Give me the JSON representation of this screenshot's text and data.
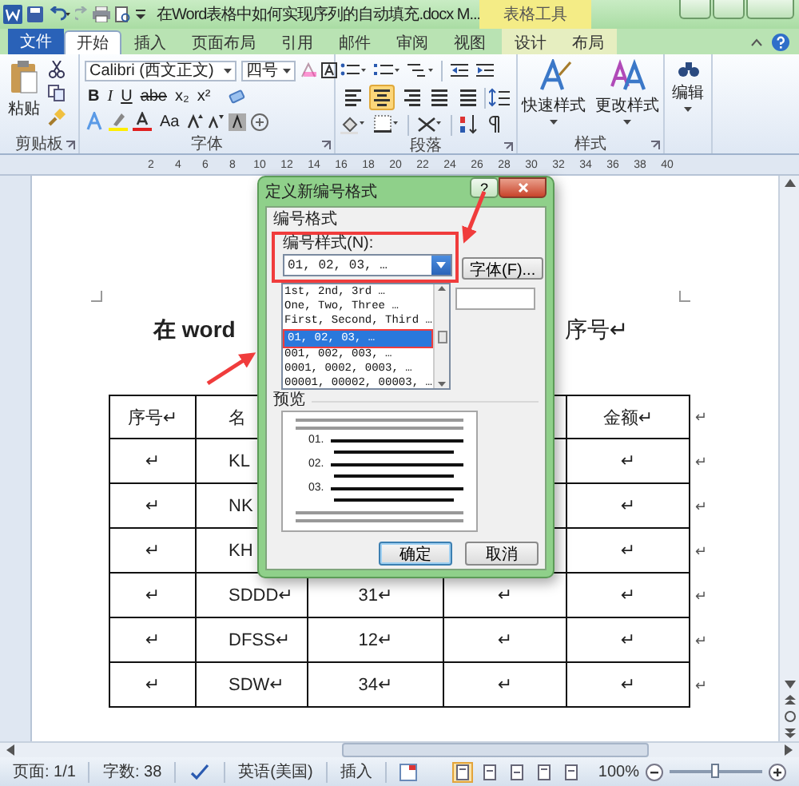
{
  "window": {
    "title": "在Word表格中如何实现序列的自动填充.docx M...",
    "context_group": "表格工具"
  },
  "file_tab": "文件",
  "tabs": [
    {
      "label": "开始",
      "selected": true,
      "contextual": false
    },
    {
      "label": "插入",
      "selected": false,
      "contextual": false
    },
    {
      "label": "页面布局",
      "selected": false,
      "contextual": false
    },
    {
      "label": "引用",
      "selected": false,
      "contextual": false
    },
    {
      "label": "邮件",
      "selected": false,
      "contextual": false
    },
    {
      "label": "审阅",
      "selected": false,
      "contextual": false
    },
    {
      "label": "视图",
      "selected": false,
      "contextual": false
    },
    {
      "label": "设计",
      "selected": false,
      "contextual": true
    },
    {
      "label": "布局",
      "selected": false,
      "contextual": true
    }
  ],
  "ribbon": {
    "clipboard": {
      "label": "剪贴板",
      "paste": "粘贴"
    },
    "font": {
      "label": "字体",
      "font_name": "Calibri (西文正文)",
      "font_size": "四号",
      "format_buttons": [
        "B",
        "I",
        "U",
        "abe",
        "x₂",
        "x²"
      ],
      "case_button": "Aa"
    },
    "paragraph": {
      "label": "段落",
      "align_buttons": [
        {
          "selected": false
        },
        {
          "selected": true
        },
        {
          "selected": false
        },
        {
          "selected": false
        },
        {
          "selected": false
        }
      ]
    },
    "styles": {
      "label": "样式",
      "buttons": [
        "快速样式",
        "更改样式"
      ]
    },
    "editing": {
      "label": "编辑"
    }
  },
  "ruler": [
    "2",
    "4",
    "6",
    "8",
    "10",
    "12",
    "14",
    "16",
    "18",
    "20",
    "22",
    "24",
    "26",
    "28",
    "30",
    "32",
    "34",
    "36",
    "38",
    "40"
  ],
  "document": {
    "heading_start": "在 word",
    "heading_end": "序号↵",
    "table": {
      "header": {
        "cells": [
          "序号↵",
          "名",
          null,
          null,
          "金额↵"
        ],
        "end": "↵"
      },
      "rows": [
        {
          "cells": [
            "↵",
            "KL",
            null,
            null,
            "↵"
          ],
          "end": "↵"
        },
        {
          "cells": [
            "↵",
            "NK",
            null,
            null,
            "↵"
          ],
          "end": "↵"
        },
        {
          "cells": [
            "↵",
            "KH",
            null,
            null,
            "↵"
          ],
          "end": "↵"
        },
        {
          "cells": [
            "↵",
            "SDDD↵",
            "31↵",
            "↵",
            "↵"
          ],
          "end": "↵"
        },
        {
          "cells": [
            "↵",
            "DFSS↵",
            "12↵",
            "↵",
            "↵"
          ],
          "end": "↵"
        },
        {
          "cells": [
            "↵",
            "SDW↵",
            "34↵",
            "↵",
            "↵"
          ],
          "end": "↵"
        }
      ]
    }
  },
  "dialog": {
    "title": "定义新编号格式",
    "help": "?",
    "group": "编号格式",
    "style_label": "编号样式(N):",
    "style_value": "01, 02, 03, …",
    "font_button": "字体(F)...",
    "style_options": [
      {
        "label": "1st, 2nd, 3rd …",
        "selected": false
      },
      {
        "label": "One, Two, Three …",
        "selected": false
      },
      {
        "label": "First, Second, Third …",
        "selected": false
      },
      {
        "label": "01, 02, 03, …",
        "selected": true
      },
      {
        "label": "001, 002, 003, …",
        "selected": false
      },
      {
        "label": "0001, 0002, 0003, …",
        "selected": false
      },
      {
        "label": "00001, 00002, 00003, …",
        "selected": false
      }
    ],
    "preview_label": "预览",
    "preview_numbers": [
      "01.",
      "02.",
      "03."
    ],
    "ok": "确定",
    "cancel": "取消"
  },
  "status_bar": {
    "page": "页面: 1/1",
    "words": "字数: 38",
    "language": "英语(美国)",
    "mode": "插入",
    "zoom": "100%",
    "zoom_slider": {
      "level": 0.5
    },
    "views": [
      {
        "selected": true
      },
      {
        "selected": false
      },
      {
        "selected": false
      },
      {
        "selected": false
      },
      {
        "selected": false
      }
    ]
  }
}
